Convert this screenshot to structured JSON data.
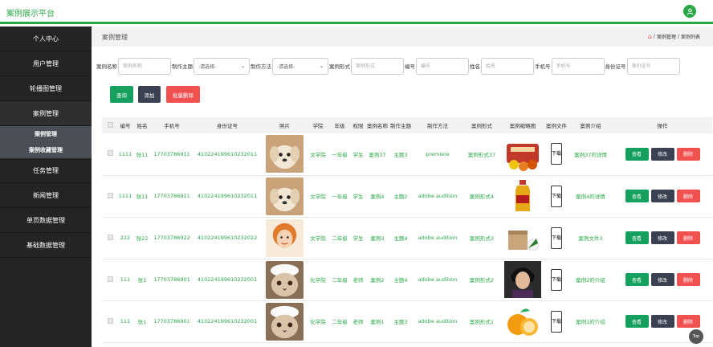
{
  "header": {
    "title": "案例展示平台"
  },
  "sidebar": {
    "items": [
      {
        "label": "个人中心"
      },
      {
        "label": "用户管理"
      },
      {
        "label": "轮播图管理"
      },
      {
        "label": "案例管理"
      },
      {
        "label": "任务管理"
      },
      {
        "label": "新闻管理"
      },
      {
        "label": "单页数据管理"
      },
      {
        "label": "基础数据管理"
      }
    ],
    "submenu": [
      {
        "label": "案例管理"
      },
      {
        "label": "案例收藏管理"
      }
    ]
  },
  "page": {
    "title": "案例管理",
    "breadcrumb": {
      "level1": "案例管理",
      "sep": "/",
      "level2": "案例列表"
    }
  },
  "search": {
    "fields": [
      {
        "label": "案例名称",
        "placeholder": "案例名称"
      },
      {
        "label": "制作主题",
        "select": "-请选择-"
      },
      {
        "label": "制作方法",
        "select": "-请选择-"
      },
      {
        "label": "案例形式",
        "placeholder": "案例形式"
      },
      {
        "label": "编号",
        "placeholder": "编号"
      },
      {
        "label": "姓名",
        "placeholder": "姓名"
      },
      {
        "label": "手机号",
        "placeholder": "手机号"
      },
      {
        "label": "身份证号",
        "placeholder": "身份证号"
      }
    ]
  },
  "actions": {
    "query": "查询",
    "add": "添加",
    "batch_delete": "批量删除"
  },
  "table": {
    "headers": [
      "",
      "编号",
      "姓名",
      "手机号",
      "身份证号",
      "照片",
      "学院",
      "年级",
      "权限",
      "案例名称",
      "制作主题",
      "制作方法",
      "案例形式",
      "案例缩略图",
      "案例文件",
      "案例介绍",
      "操作"
    ],
    "rows": [
      {
        "id": "1111",
        "name": "张11",
        "phone": "17703786911",
        "idcard": "410224199610232011",
        "college": "文学院",
        "grade": "一年级",
        "role": "学生",
        "case_name": "案例37",
        "theme": "主题3",
        "method": "premiere",
        "form": "案例形式37",
        "file": "下载",
        "intro": "案例37的详情"
      },
      {
        "id": "1111",
        "name": "张11",
        "phone": "17703786911",
        "idcard": "410224199610232011",
        "college": "文学院",
        "grade": "一年级",
        "role": "学生",
        "case_name": "案例4",
        "theme": "主题2",
        "method": "adobe audition",
        "form": "案例形式4",
        "file": "下载",
        "intro": "案例4的详情"
      },
      {
        "id": "222",
        "name": "张22",
        "phone": "17703786922",
        "idcard": "410224199610232022",
        "college": "文学院",
        "grade": "二年级",
        "role": "学生",
        "case_name": "案例3",
        "theme": "主题4",
        "method": "adobe audition",
        "form": "案例形式3",
        "file": "下载",
        "intro": "案例文件3"
      },
      {
        "id": "111",
        "name": "张1",
        "phone": "17703786901",
        "idcard": "410224199610232001",
        "college": "化学院",
        "grade": "二年级",
        "role": "老师",
        "case_name": "案例2",
        "theme": "主题4",
        "method": "adobe audition",
        "form": "案例形式2",
        "file": "下载",
        "intro": "案例2的介绍"
      },
      {
        "id": "111",
        "name": "张1",
        "phone": "17703786901",
        "idcard": "410224199610232001",
        "college": "化学院",
        "grade": "二年级",
        "role": "老师",
        "case_name": "案例1",
        "theme": "主题3",
        "method": "adobe audition",
        "form": "案例形式1",
        "file": "下载",
        "intro": "案例1的介绍"
      }
    ],
    "row_actions": {
      "view": "查看",
      "edit": "修改",
      "delete": "删除"
    }
  },
  "back_to_top": "Top",
  "colors": {
    "accent": "#28a745",
    "sidebar": "#242424",
    "danger": "#f05050",
    "dark": "#3a4150"
  }
}
